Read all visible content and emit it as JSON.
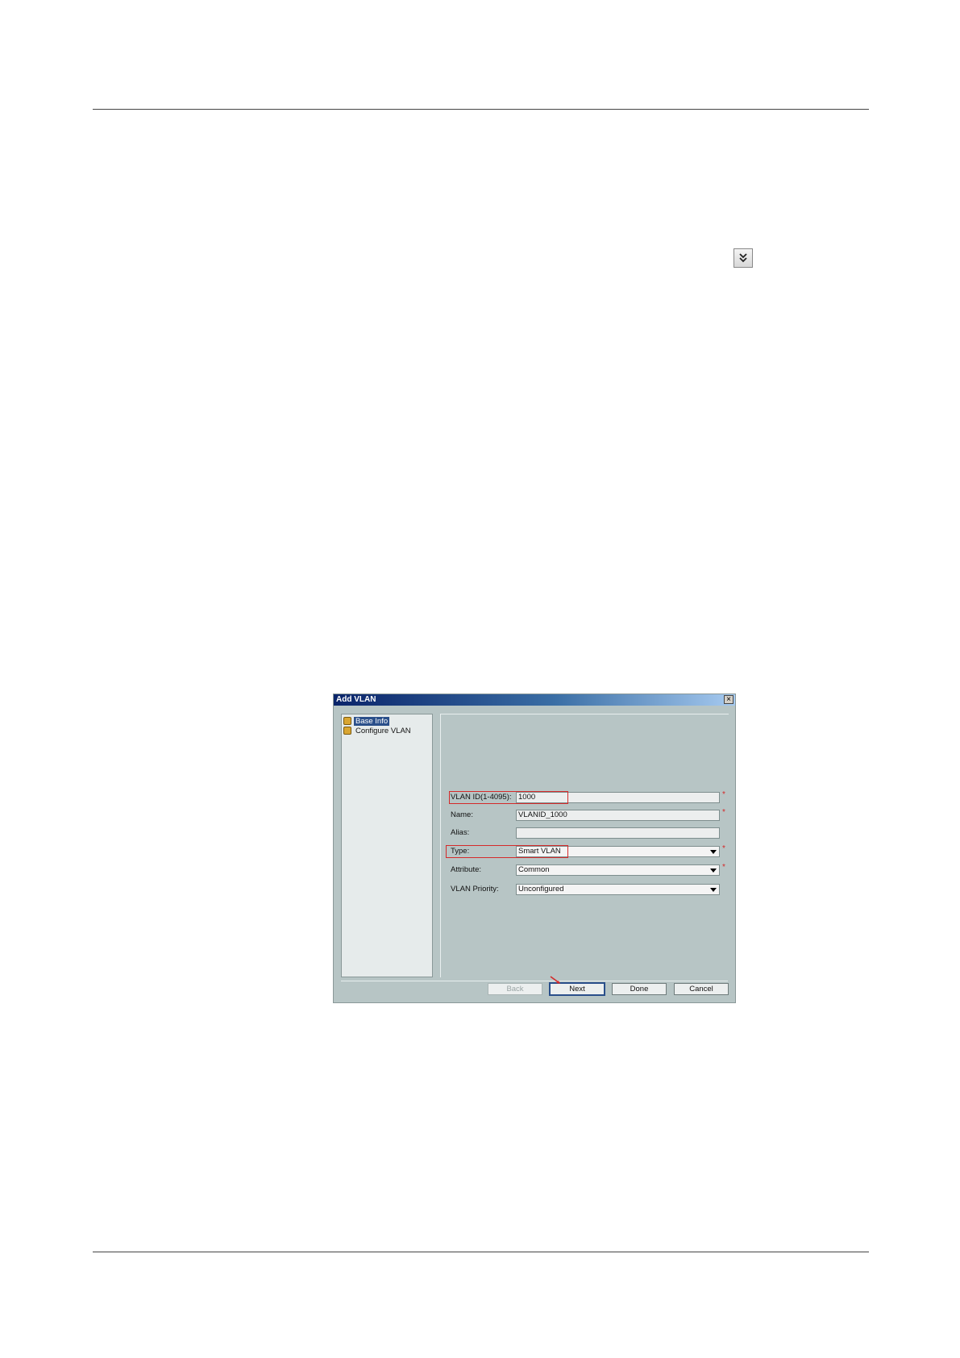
{
  "dialog": {
    "title": "Add VLAN",
    "close_symbol": "×",
    "tree": [
      {
        "label": "Base Info",
        "selected": true,
        "icon": "folder-icon"
      },
      {
        "label": "Configure VLAN",
        "selected": false,
        "icon": "folder-icon"
      }
    ],
    "fields": {
      "vlan_id": {
        "label": "VLAN ID(1-4095):",
        "value": "1000",
        "required": "*"
      },
      "name": {
        "label": "Name:",
        "value": "VLANID_1000",
        "required": "*"
      },
      "alias": {
        "label": "Alias:",
        "value": ""
      },
      "type": {
        "label": "Type:",
        "value": "Smart VLAN",
        "required": "*"
      },
      "attribute": {
        "label": "Attribute:",
        "value": "Common",
        "required": "*"
      },
      "vlan_priority": {
        "label": "VLAN Priority:",
        "value": "Unconfigured"
      }
    },
    "buttons": {
      "back": "Back",
      "next": "Next",
      "done": "Done",
      "cancel": "Cancel"
    },
    "colors": {
      "highlight": "#d42a2a",
      "titlebar": "#0a246a",
      "background": "#b7c5c5"
    }
  },
  "page": {
    "expand_icon": "double-chevron-down-icon"
  }
}
